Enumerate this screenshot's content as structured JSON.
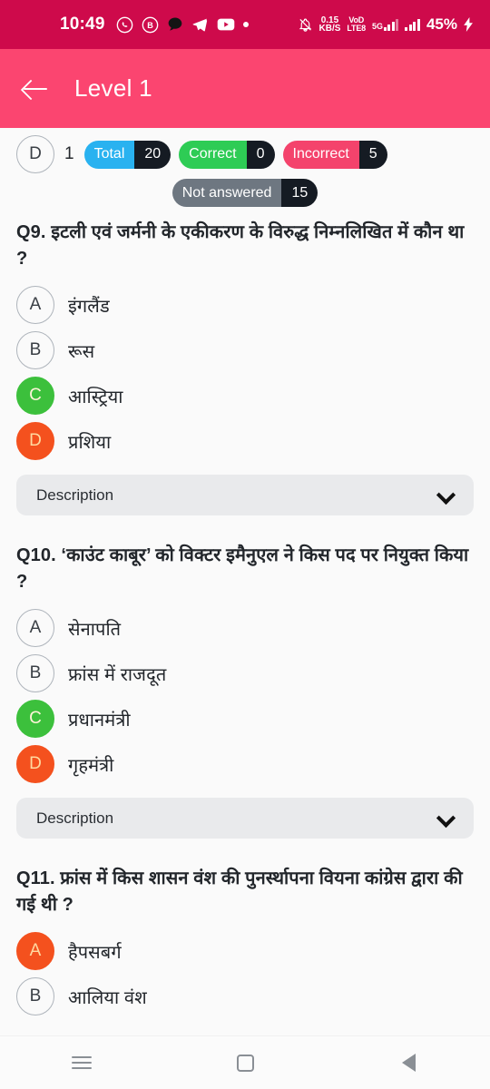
{
  "statusbar": {
    "time": "10:49",
    "left_icons": [
      "whatsapp-icon",
      "b-circle-icon",
      "chat-bubble-icon",
      "telegram-icon",
      "youtube-icon",
      "dot-icon"
    ],
    "data_rate": "0.15",
    "data_rate_unit": "KB/S",
    "volte_top": "VoD",
    "volte_bottom": "LTE8",
    "network": "5G",
    "battery": "45%",
    "charging": true
  },
  "appbar": {
    "back_label": "back-arrow",
    "title": "Level 1"
  },
  "stats": {
    "prev_option_letter": "D",
    "index": "1",
    "chips": [
      {
        "label": "Total",
        "value": "20",
        "color": "#29B2F0"
      },
      {
        "label": "Correct",
        "value": "0",
        "color": "#2ECC55"
      },
      {
        "label": "Incorrect",
        "value": "5",
        "color": "#F4436C"
      },
      {
        "label": "Not answered",
        "value": "15",
        "color": "#6E7781"
      }
    ]
  },
  "questions": [
    {
      "text": "Q9. इटली एवं जर्मनी के एकीकरण के विरुद्ध निम्नलिखित में कौन था ?",
      "options": [
        {
          "letter": "A",
          "text": "इंगलैंड",
          "state": "none"
        },
        {
          "letter": "B",
          "text": "रूस",
          "state": "none"
        },
        {
          "letter": "C",
          "text": "आस्ट्रिया",
          "state": "correct"
        },
        {
          "letter": "D",
          "text": "प्रशिया",
          "state": "wrong"
        }
      ],
      "description_label": "Description"
    },
    {
      "text": "Q10. ‘काउंट काबूर’ को विक्टर इमैनुएल ने किस पद पर नियुक्त किया ?",
      "options": [
        {
          "letter": "A",
          "text": "सेनापति",
          "state": "none"
        },
        {
          "letter": "B",
          "text": "फ्रांस में राजदूत",
          "state": "none"
        },
        {
          "letter": "C",
          "text": "प्रधानमंत्री",
          "state": "correct"
        },
        {
          "letter": "D",
          "text": "गृहमंत्री",
          "state": "wrong"
        }
      ],
      "description_label": "Description"
    },
    {
      "text": "Q11. फ्रांस में किस शासन वंश की पुनर्स्थापना वियना कांग्रेस द्वारा की गई थी ?",
      "options": [
        {
          "letter": "A",
          "text": "हैपसबर्ग",
          "state": "wrong"
        },
        {
          "letter": "B",
          "text": "आलिया वंश",
          "state": "none"
        }
      ],
      "description_label": ""
    }
  ],
  "navbar": {
    "recents": "recents-icon",
    "home": "home-icon",
    "back": "back-icon"
  },
  "colors": {
    "status_bar": "#CE0A4B",
    "app_bar": "#FB4570",
    "page_bg": "#FAFAFA",
    "correct": "#3CC03C",
    "wrong": "#F4511E",
    "chip_value_bg": "#151B23"
  }
}
